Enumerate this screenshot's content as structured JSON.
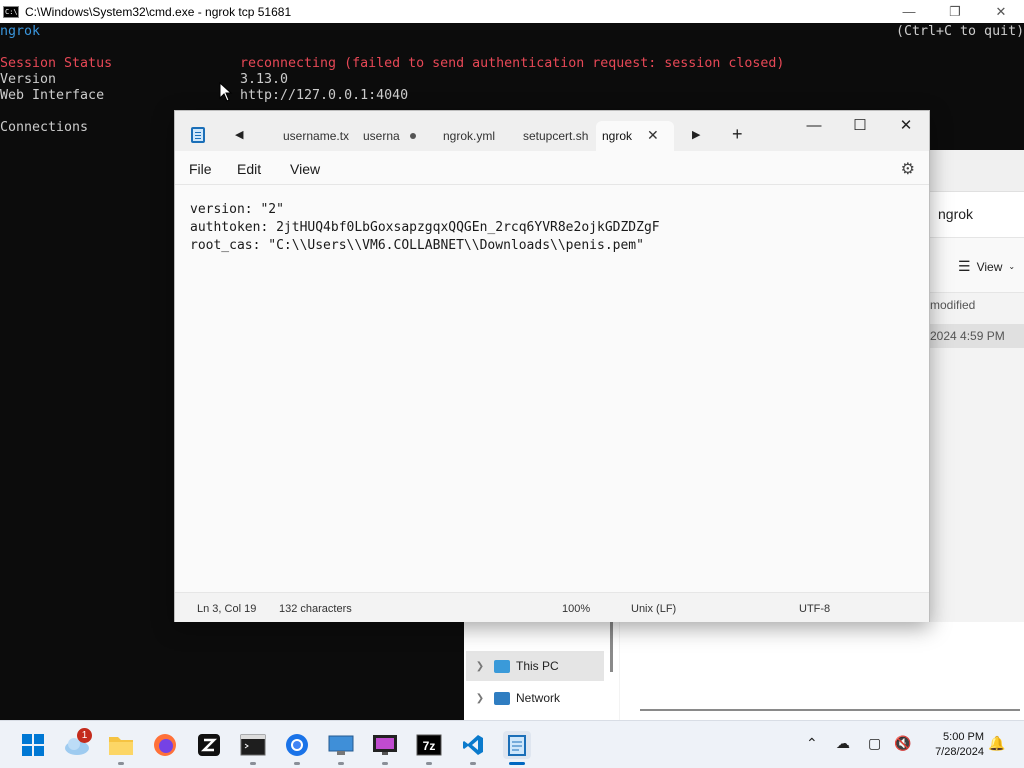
{
  "cmd": {
    "title": "C:\\Windows\\System32\\cmd.exe - ngrok  tcp 51681",
    "header_left": "ngrok",
    "header_right": "(Ctrl+C to quit)",
    "rows": [
      {
        "label": "Session Status",
        "value": "reconnecting (failed to send authentication request: session closed)"
      },
      {
        "label": "Version",
        "value": "3.13.0"
      },
      {
        "label": "Web Interface",
        "value": "http://127.0.0.1:4040"
      },
      {
        "label": "Connections",
        "value": ""
      }
    ]
  },
  "explorer": {
    "address": "ngrok",
    "view_label": "View",
    "column_modified": "modified",
    "row_date": "2024 4:59 PM",
    "nav": [
      {
        "label": "This PC"
      },
      {
        "label": "Network"
      }
    ]
  },
  "notepad": {
    "tabs": [
      {
        "label": "username.tx"
      },
      {
        "label": "userna"
      },
      {
        "label": "ngrok.yml"
      },
      {
        "label": "setupcert.sh"
      },
      {
        "label": "ngrok"
      }
    ],
    "menu": {
      "file": "File",
      "edit": "Edit",
      "view": "View"
    },
    "lines": [
      "version: \"2\"",
      "authtoken: 2jtHUQ4bf0LbGoxsapzgqxQQGEn_2rcq6YVR8e2ojkGDZDZgF",
      "root_cas: \"C:\\\\Users\\\\VM6.COLLABNET\\\\Downloads\\\\penis.pem\""
    ],
    "status": {
      "position": "Ln 3, Col 19",
      "characters": "132 characters",
      "zoom": "100%",
      "line_ending": "Unix (LF)",
      "encoding": "UTF-8"
    }
  },
  "taskbar": {
    "widgets_badge": "1",
    "time": "5:00 PM",
    "date": "7/28/2024",
    "accent": "#0067c0"
  }
}
